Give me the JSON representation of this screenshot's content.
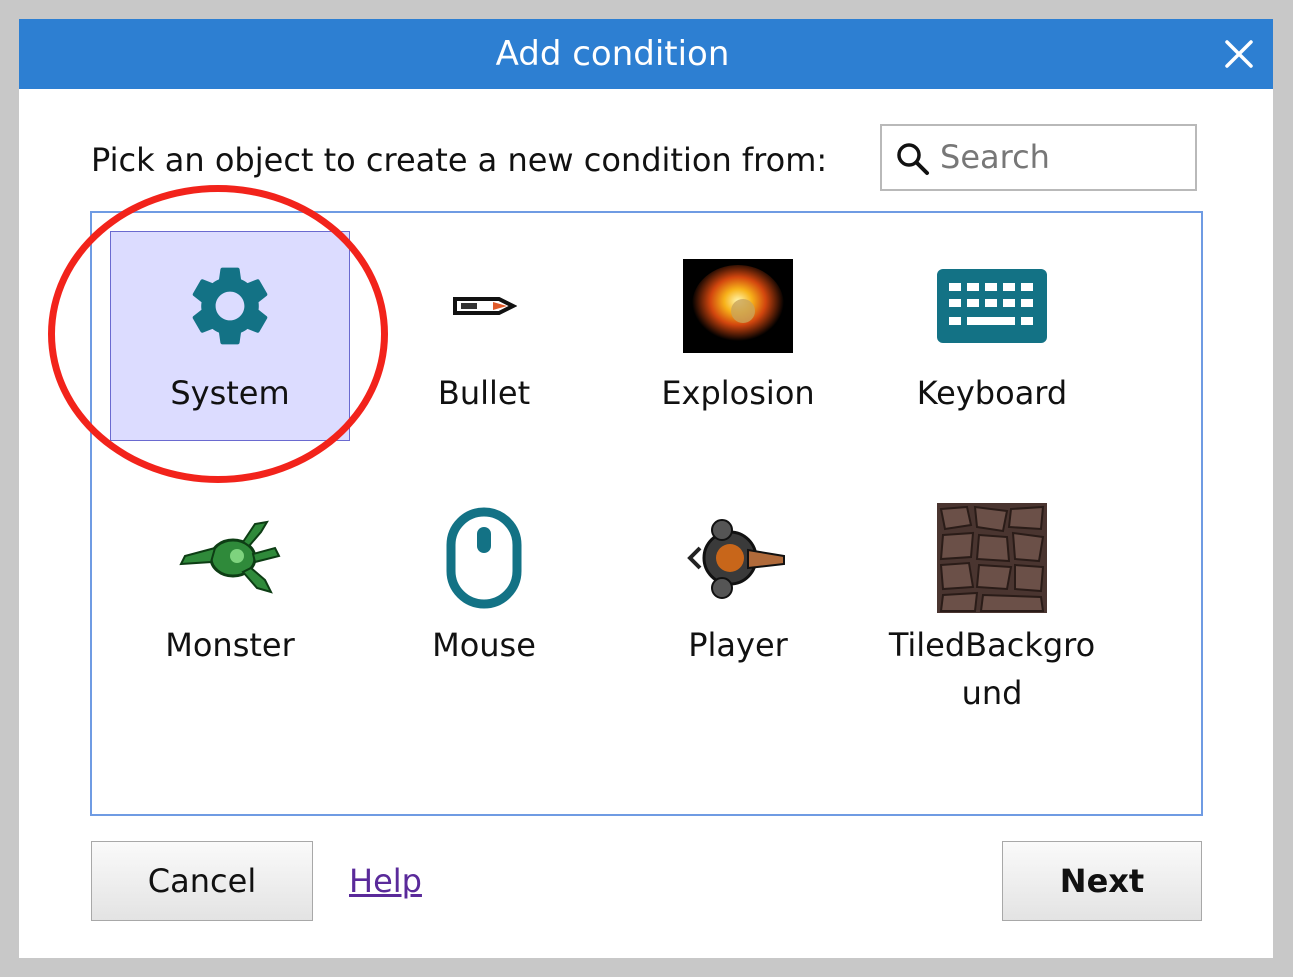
{
  "dialog": {
    "title": "Add condition",
    "prompt": "Pick an object to create a new condition from:",
    "search": {
      "placeholder": "Search",
      "value": ""
    },
    "objects": [
      {
        "label": "System",
        "icon": "gear-icon",
        "selected": true
      },
      {
        "label": "Bullet",
        "icon": "bullet-sprite-icon"
      },
      {
        "label": "Explosion",
        "icon": "explosion-sprite-icon"
      },
      {
        "label": "Keyboard",
        "icon": "keyboard-icon"
      },
      {
        "label": "Monster",
        "icon": "monster-sprite-icon"
      },
      {
        "label": "Mouse",
        "icon": "mouse-icon"
      },
      {
        "label": "Player",
        "icon": "player-sprite-icon"
      },
      {
        "label": "TiledBackgro\nund",
        "icon": "tiled-background-icon"
      }
    ],
    "buttons": {
      "cancel": "Cancel",
      "help": "Help",
      "next": "Next"
    },
    "colors": {
      "titlebar": "#2d7fd2",
      "accent_icon": "#137285",
      "selection": "#dcdcff",
      "annotation": "#f2231b"
    }
  }
}
